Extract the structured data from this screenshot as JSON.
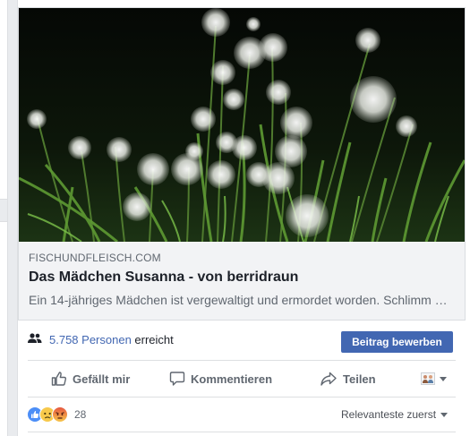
{
  "link_preview": {
    "image_alt": "Pusteblumen",
    "domain": "FISCHUNDFLEISCH.COM",
    "title": "Das Mädchen Susanna - von berridraun",
    "description": "Ein 14-jähriges Mädchen ist vergewaltigt und ermordet worden. Schlimm genug..."
  },
  "reach": {
    "icon": "people-icon",
    "count": "5.758 Personen",
    "suffix": "erreicht"
  },
  "boost_button": {
    "label": "Beitrag bewerben"
  },
  "actions": {
    "like": {
      "icon": "thumbs-up-icon",
      "label": "Gefällt mir"
    },
    "comment": {
      "icon": "comment-icon",
      "label": "Kommentieren"
    },
    "share": {
      "icon": "share-icon",
      "label": "Teilen"
    },
    "audience": {
      "icon": "audience-avatar-icon"
    }
  },
  "reactions": {
    "icons": [
      "like-reaction-icon",
      "sad-reaction-icon",
      "angry-reaction-icon"
    ],
    "count": "28",
    "sort_label": "Relevanteste zuerst"
  },
  "colors": {
    "brand_blue": "#4267b2",
    "text_primary": "#1d2129",
    "text_secondary": "#606770",
    "page_bg": "#e9ebee"
  }
}
